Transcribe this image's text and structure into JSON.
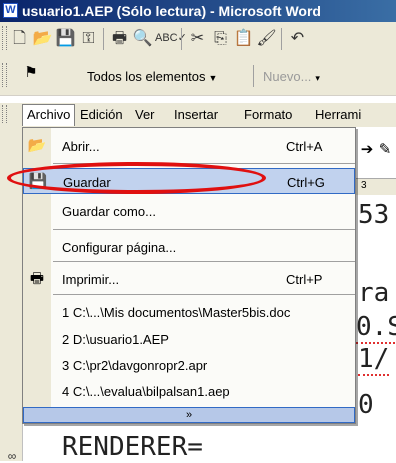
{
  "window": {
    "title": "usuario1.AEP (Sólo lectura) - Microsoft Word",
    "app_icon": "word-icon"
  },
  "toolbar_standard": {
    "icons": [
      "new-document-icon",
      "open-folder-icon",
      "save-icon",
      "permission-icon",
      "print-icon",
      "print-preview-icon",
      "spelling-icon",
      "cut-icon",
      "copy-icon",
      "paste-icon",
      "format-painter-icon",
      "undo-icon"
    ]
  },
  "toolbar_formatting": {
    "icon": "styles-pane-icon",
    "styles_dropdown": "Todos los elementos",
    "new_dropdown": "Nuevo..."
  },
  "menubar": {
    "items": [
      "Archivo",
      "Edición",
      "Ver",
      "Insertar",
      "Formato",
      "Herrami"
    ]
  },
  "file_menu": {
    "items": [
      {
        "label": "Abrir...",
        "shortcut": "Ctrl+A",
        "icon": "open-folder-icon"
      },
      {
        "label": "Guardar",
        "shortcut": "Ctrl+G",
        "icon": "save-icon"
      },
      {
        "label": "Guardar como...",
        "shortcut": "",
        "icon": ""
      },
      {
        "label": "Configurar página...",
        "shortcut": "",
        "icon": ""
      },
      {
        "label": "Imprimir...",
        "shortcut": "Ctrl+P",
        "icon": "print-icon"
      },
      {
        "label": "1 C:\\...\\Mis documentos\\Master5bis.doc",
        "shortcut": "",
        "icon": ""
      },
      {
        "label": "2 D:\\usuario1.AEP",
        "shortcut": "",
        "icon": ""
      },
      {
        "label": "3 C:\\pr2\\davgonropr2.apr",
        "shortcut": "",
        "icon": ""
      },
      {
        "label": "4 C:\\...\\evalua\\bilpalsan1.aep",
        "shortcut": "",
        "icon": ""
      }
    ],
    "expand_icon": "chevron-double-down-icon"
  },
  "ruler": {
    "tick": "3"
  },
  "document": {
    "fragments": [
      "53",
      "ra",
      "0.S",
      "1/",
      "0"
    ],
    "bottom_line": "RENDERER="
  }
}
